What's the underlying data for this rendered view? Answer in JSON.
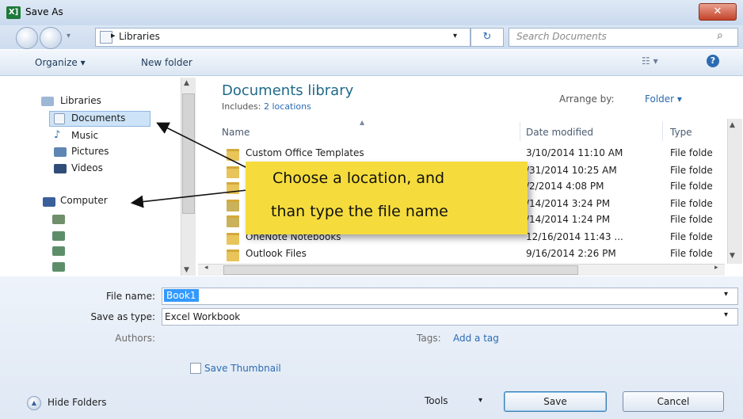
{
  "window": {
    "title": "Save As",
    "app_badge": "X]",
    "close_label": "✕"
  },
  "address": {
    "path": "Libraries",
    "search_placeholder": "Search Documents"
  },
  "toolbar": {
    "organize": "Organize ▾",
    "new_folder": "New folder"
  },
  "nav": {
    "libraries": "Libraries",
    "documents": "Documents",
    "music": "Music",
    "pictures": "Pictures",
    "videos": "Videos",
    "computer": "Computer"
  },
  "library": {
    "title": "Documents library",
    "includes_label": "Includes:",
    "includes_link": "2 locations",
    "arrange_label": "Arrange by:",
    "arrange_value": "Folder ▾"
  },
  "columns": {
    "name": "Name",
    "date": "Date modified",
    "type": "Type"
  },
  "files": [
    {
      "name": "Custom Office Templates",
      "date": "3/10/2014 11:10 AM",
      "type": "File folde"
    },
    {
      "name": "",
      "date": "/31/2014 10:25 AM",
      "type": "File folde"
    },
    {
      "name": "",
      "date": "/2/2014 4:08 PM",
      "type": "File folde"
    },
    {
      "name": "",
      "date": "/14/2014 3:24 PM",
      "type": "File folde"
    },
    {
      "name": "",
      "date": "/14/2014 1:24 PM",
      "type": "File folde"
    },
    {
      "name": "OneNote Notebooks",
      "date": "12/16/2014 11:43 ...",
      "type": "File folde"
    },
    {
      "name": "Outlook Files",
      "date": "9/16/2014 2:26 PM",
      "type": "File folde"
    }
  ],
  "callout": {
    "line1": "Choose a location, and",
    "line2": "than type the file name"
  },
  "form": {
    "file_name_label": "File name:",
    "file_name_value": "Book1",
    "save_type_label": "Save as type:",
    "save_type_value": "Excel Workbook",
    "authors_label": "Authors:",
    "tags_label": "Tags:",
    "tags_link": "Add a tag",
    "thumbnail_label": "Save Thumbnail"
  },
  "footer": {
    "hide_folders": "Hide Folders",
    "tools": "Tools",
    "save": "Save",
    "cancel": "Cancel"
  },
  "colors": {
    "accent": "#2b6bb3",
    "callout": "#f5dc3c"
  }
}
